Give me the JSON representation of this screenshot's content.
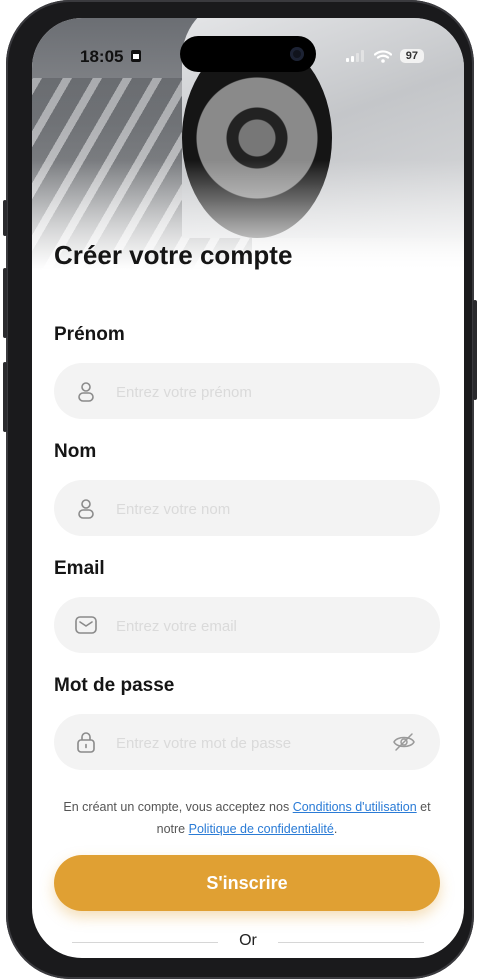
{
  "status_bar": {
    "time": "18:05",
    "battery": "97"
  },
  "page": {
    "title": "Créer votre compte"
  },
  "form": {
    "first_name": {
      "label": "Prénom",
      "placeholder": "Entrez votre prénom"
    },
    "last_name": {
      "label": "Nom",
      "placeholder": "Entrez votre nom"
    },
    "email": {
      "label": "Email",
      "placeholder": "Entrez votre email"
    },
    "password": {
      "label": "Mot de passe",
      "placeholder": "Entrez votre mot de passe"
    }
  },
  "terms": {
    "prefix": "En créant un compte, vous acceptez nos ",
    "conditions_link": "Conditions d'utilisation",
    "middle": " et notre ",
    "privacy_link": "Politique de confidentialité",
    "suffix": "."
  },
  "actions": {
    "signup_label": "S'inscrire",
    "or_label": "Or"
  },
  "colors": {
    "accent": "#e0a033",
    "link": "#2a7bd6",
    "field_bg": "#f3f3f3"
  },
  "icons": [
    "user-icon",
    "mail-icon",
    "lock-icon",
    "eye-off-icon",
    "signal-icon",
    "wifi-icon",
    "sim-icon"
  ]
}
